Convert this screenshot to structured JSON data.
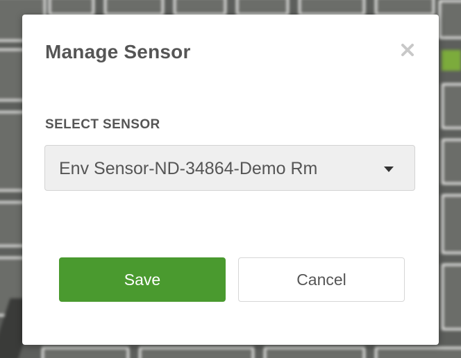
{
  "modal": {
    "title": "Manage Sensor",
    "close_icon": "close-icon",
    "field_label": "SELECT SENSOR",
    "selected_sensor": "Env Sensor-ND-34864-Demo Rm",
    "dropdown_icon": "caret-down-icon",
    "save_label": "Save",
    "cancel_label": "Cancel"
  },
  "colors": {
    "primary": "#4a9a2f",
    "text": "#555555",
    "select_bg": "#efefef"
  }
}
